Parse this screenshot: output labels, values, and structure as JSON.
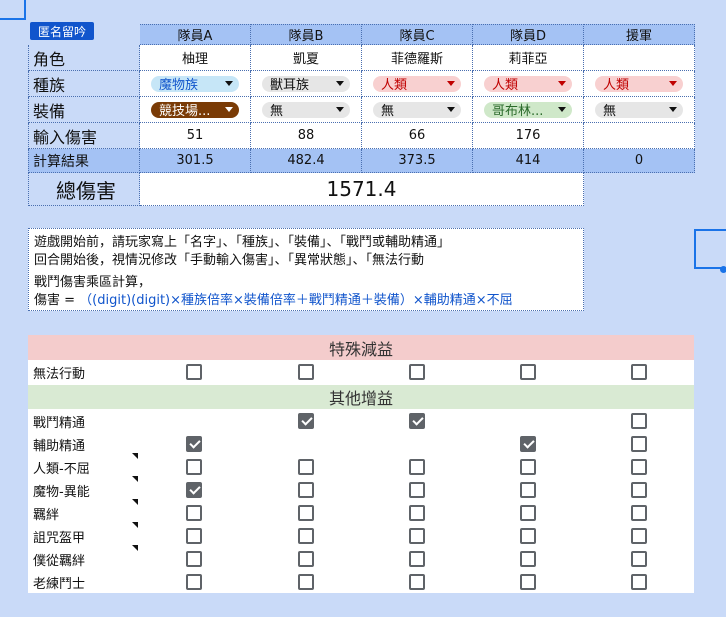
{
  "badge": "匿名留吟",
  "columns": [
    "隊員A",
    "隊員B",
    "隊員C",
    "隊員D",
    "援軍"
  ],
  "rows": {
    "role": {
      "label": "角色",
      "values": [
        "柚理",
        "凱夏",
        "菲德羅斯",
        "莉菲亞",
        ""
      ]
    },
    "race": {
      "label": "種族",
      "values": [
        "魔物族",
        "獸耳族",
        "人類",
        "人類",
        "人類"
      ]
    },
    "equip": {
      "label": "裝備",
      "values": [
        "競技場...",
        "無",
        "無",
        "哥布林...",
        "無"
      ]
    },
    "damage": {
      "label": "輸入傷害",
      "values": [
        "51",
        "88",
        "66",
        "176",
        ""
      ]
    },
    "result": {
      "label": "計算結果",
      "values": [
        "301.5",
        "482.4",
        "373.5",
        "414",
        "0"
      ]
    }
  },
  "total": {
    "label": "總傷害",
    "value": "1571.4"
  },
  "notes": {
    "line1": "遊戲開始前，請玩家寫上「名字」、「種族」、「裝備」、「戰鬥或輔助精通」",
    "line2": "回合開始後，視情況修改「手動輸入傷害」、「異常狀態」、「無法行動",
    "line3": "戰鬥傷害乘區計算，",
    "line4_prefix": "傷害 = ",
    "line4_formula": "（(digit)(digit)×種族倍率×裝備倍率＋戰鬥精通＋裝備）×輔助精通×不屈"
  },
  "debuff": {
    "title": "特殊減益",
    "rows": [
      {
        "label": "無法行動",
        "checks": [
          false,
          false,
          false,
          false,
          false
        ]
      }
    ]
  },
  "buff": {
    "title": "其他增益",
    "rows": [
      {
        "label": "戰鬥精通",
        "checks": [
          null,
          true,
          true,
          null,
          false
        ]
      },
      {
        "label": "輔助精通",
        "checks": [
          true,
          null,
          null,
          true,
          false
        ]
      },
      {
        "label": "人類-不屈",
        "checks": [
          false,
          false,
          false,
          false,
          false
        ]
      },
      {
        "label": "魔物-異能",
        "checks": [
          true,
          false,
          false,
          false,
          false
        ]
      },
      {
        "label": "羈絆",
        "checks": [
          false,
          false,
          false,
          false,
          false
        ]
      },
      {
        "label": "詛咒盔甲",
        "checks": [
          false,
          false,
          false,
          false,
          false
        ]
      },
      {
        "label": "僕從羈絆",
        "checks": [
          false,
          false,
          false,
          false,
          false
        ]
      },
      {
        "label": "老練鬥士",
        "checks": [
          false,
          false,
          false,
          false,
          false
        ]
      }
    ]
  },
  "colors": {
    "background": "#c9daf8",
    "header": "#a4c2f4",
    "debuff_band": "#f4cccc",
    "buff_band": "#d9ead3"
  }
}
